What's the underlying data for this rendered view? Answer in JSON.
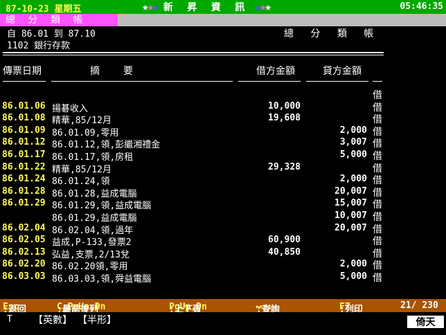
{
  "topbar": {
    "date": "87-10-23",
    "weekday": "星期五",
    "brand": "新 昇 資 訊",
    "time": "05:46:35"
  },
  "menubar": {
    "title": "總 分 類 帳"
  },
  "report": {
    "period_from_label": "自",
    "period_from": "86.01",
    "period_to_label": "到",
    "period_to": "87.10",
    "title": "總 分 類 帳",
    "account_code": "1102",
    "account_name": "銀行存款"
  },
  "columns": {
    "date": "傳票日期",
    "summary": "摘要",
    "debit": "借方金額",
    "credit": "貸方金額"
  },
  "rows": [
    {
      "date": "",
      "summary": "",
      "debit": "",
      "credit": "",
      "flag": "借"
    },
    {
      "date": "86.01.06",
      "summary": "揚碁收入",
      "debit": "10,000",
      "credit": "",
      "flag": "借"
    },
    {
      "date": "86.01.08",
      "summary": "精華,85/12月",
      "debit": "19,608",
      "credit": "",
      "flag": "借"
    },
    {
      "date": "86.01.09",
      "summary": "86.01.09,零用",
      "debit": "",
      "credit": "2,000",
      "flag": "借"
    },
    {
      "date": "86.01.12",
      "summary": "86.01.12,領,彭繼湘禮金",
      "debit": "",
      "credit": "3,007",
      "flag": "借"
    },
    {
      "date": "86.01.17",
      "summary": "86.01.17,領,房租",
      "debit": "",
      "credit": "5,000",
      "flag": "借"
    },
    {
      "date": "86.01.22",
      "summary": "精華,85/12月",
      "debit": "29,328",
      "credit": "",
      "flag": "借"
    },
    {
      "date": "86.01.24",
      "summary": "86.01.24,領",
      "debit": "",
      "credit": "2,000",
      "flag": "借"
    },
    {
      "date": "86.01.28",
      "summary": "86.01.28,益成電腦",
      "debit": "",
      "credit": "20,007",
      "flag": "借"
    },
    {
      "date": "86.01.29",
      "summary": "86.01.29,領,益成電腦",
      "debit": "",
      "credit": "15,007",
      "flag": "借"
    },
    {
      "date": "",
      "summary": "86.01.29,益成電腦",
      "debit": "",
      "credit": "10,007",
      "flag": "借"
    },
    {
      "date": "86.02.04",
      "summary": "86.02.04,領,過年",
      "debit": "",
      "credit": "20,007",
      "flag": "借"
    },
    {
      "date": "86.02.05",
      "summary": "益成,P-133,發票2",
      "debit": "60,900",
      "credit": "",
      "flag": "借"
    },
    {
      "date": "86.02.13",
      "summary": "弘益,支票,2/13兌",
      "debit": "40,850",
      "credit": "",
      "flag": "借"
    },
    {
      "date": "86.02.20",
      "summary": "86.02.20領,零用",
      "debit": "",
      "credit": "2,000",
      "flag": "借"
    },
    {
      "date": "86.03.03",
      "summary": "86.03.03,領,舜益電腦",
      "debit": "",
      "credit": "5,000",
      "flag": "借"
    }
  ],
  "help": {
    "esc_key": "Esc",
    "esc_text": ":返回",
    "pg_key": "C_PgUp,Dn",
    "pg_text": ":最前後列",
    "pgud_key": "PgUp,Dn",
    "pgud_text": ":上下頁",
    "arrows": "⟷↑↓",
    "query_text": ":查詢",
    "f7_key": "F7",
    "f7_text": ":列印",
    "counter": "21/ 230"
  },
  "status": {
    "mode": "T",
    "input1": "【英數】",
    "input2": "【半形】",
    "logo": "倚天"
  }
}
